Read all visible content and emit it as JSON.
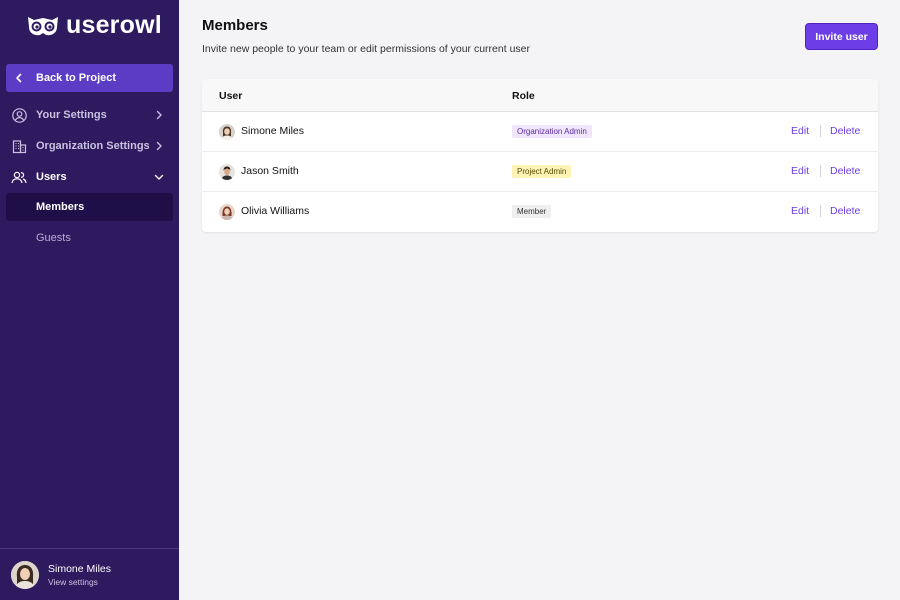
{
  "brand": {
    "name": "userowl"
  },
  "sidebar": {
    "back_label": "Back to Project",
    "items": [
      {
        "label": "Your Settings",
        "icon": "user-circle-icon"
      },
      {
        "label": "Organization Settings",
        "icon": "building-icon"
      },
      {
        "label": "Users",
        "icon": "users-icon"
      },
      {
        "label": "Members"
      },
      {
        "label": "Guests"
      }
    ],
    "footer": {
      "name": "Simone Miles",
      "sub": "View settings"
    }
  },
  "page": {
    "title": "Members",
    "subtitle": "Invite new people to your team or edit permissions of your current user",
    "invite_label": "Invite user"
  },
  "table": {
    "headers": {
      "user": "User",
      "role": "Role"
    },
    "rows": [
      {
        "name": "Simone Miles",
        "role": "Organization Admin",
        "edit": "Edit",
        "delete": "Delete"
      },
      {
        "name": "Jason Smith",
        "role": "Project Admin",
        "edit": "Edit",
        "delete": "Delete"
      },
      {
        "name": "Olivia Williams",
        "role": "Member",
        "edit": "Edit",
        "delete": "Delete"
      }
    ]
  },
  "colors": {
    "sidebar_bg": "#2e1a5e",
    "accent": "#6d3ee8",
    "active_item": "#1f0f48",
    "back_button": "#5b3cc4"
  }
}
